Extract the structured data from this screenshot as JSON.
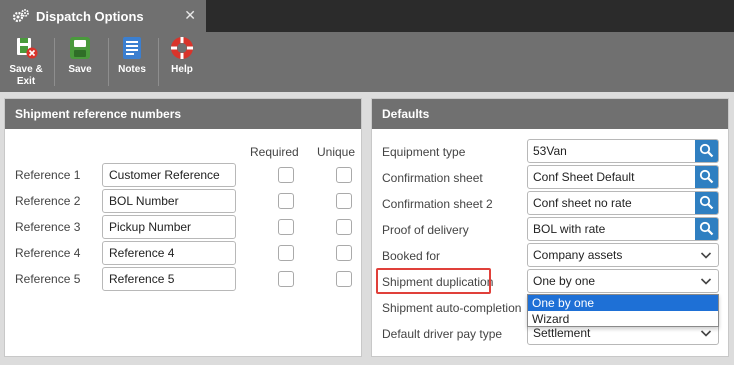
{
  "window": {
    "tab_title": "Dispatch Options",
    "close_glyph": "✕"
  },
  "toolbar": {
    "buttons": [
      {
        "label_line1": "Save &",
        "label_line2": "Exit",
        "icon": "save-exit-icon"
      },
      {
        "label": "Save",
        "icon": "save-icon"
      },
      {
        "label": "Notes",
        "icon": "notes-icon"
      },
      {
        "label": "Help",
        "icon": "help-icon"
      }
    ]
  },
  "references": {
    "title": "Shipment reference numbers",
    "col_required": "Required",
    "col_unique": "Unique",
    "rows": [
      {
        "label": "Reference 1",
        "value": "Customer Reference"
      },
      {
        "label": "Reference 2",
        "value": "BOL Number"
      },
      {
        "label": "Reference 3",
        "value": "Pickup Number"
      },
      {
        "label": "Reference 4",
        "value": "Reference 4"
      },
      {
        "label": "Reference 5",
        "value": "Reference 5"
      }
    ]
  },
  "defaults": {
    "title": "Defaults",
    "equipment_type": {
      "label": "Equipment type",
      "value": "53Van"
    },
    "confirmation_sheet": {
      "label": "Confirmation sheet",
      "value": "Conf Sheet Default"
    },
    "confirmation_sheet_2": {
      "label": "Confirmation sheet 2",
      "value": "Conf sheet no rate"
    },
    "proof_of_delivery": {
      "label": "Proof of delivery",
      "value": "BOL with rate"
    },
    "booked_for": {
      "label": "Booked for",
      "value": "Company assets"
    },
    "shipment_duplication": {
      "label": "Shipment duplication",
      "value": "One by one"
    },
    "shipment_auto_completion": {
      "label": "Shipment auto-completion"
    },
    "default_driver_pay_type": {
      "label": "Default driver pay type",
      "value": "Settlement"
    },
    "duplication_options": [
      "One by one",
      "Wizard"
    ]
  },
  "colors": {
    "accent": "#2f7fc1",
    "header_gray": "#707070",
    "highlight_red": "#e0403a",
    "option_selected": "#1e70d6"
  }
}
